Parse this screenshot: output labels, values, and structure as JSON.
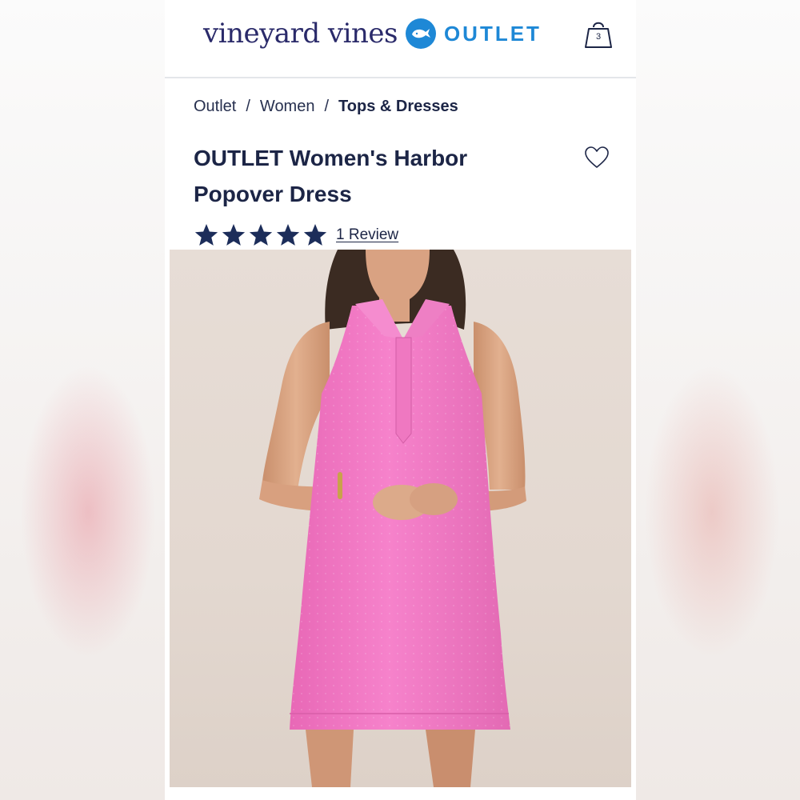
{
  "brand": {
    "name": "vineyard vines",
    "outlet_label": "OUTLET",
    "accent": "#1e88d6",
    "navy": "#1c2546"
  },
  "cart": {
    "icon": "shopping-bag-icon",
    "count": "3"
  },
  "breadcrumb": {
    "items": [
      "Outlet",
      "Women",
      "Tops & Dresses"
    ],
    "separator": "/"
  },
  "product": {
    "title": "OUTLET Women's Harbor Popover Dress",
    "favorite_icon": "heart-icon",
    "rating": 5,
    "rating_max": 5,
    "review_label": "1 Review",
    "image_alt": "Model wearing pink sleeveless popover dress",
    "dress_color": "#f47fc8"
  }
}
